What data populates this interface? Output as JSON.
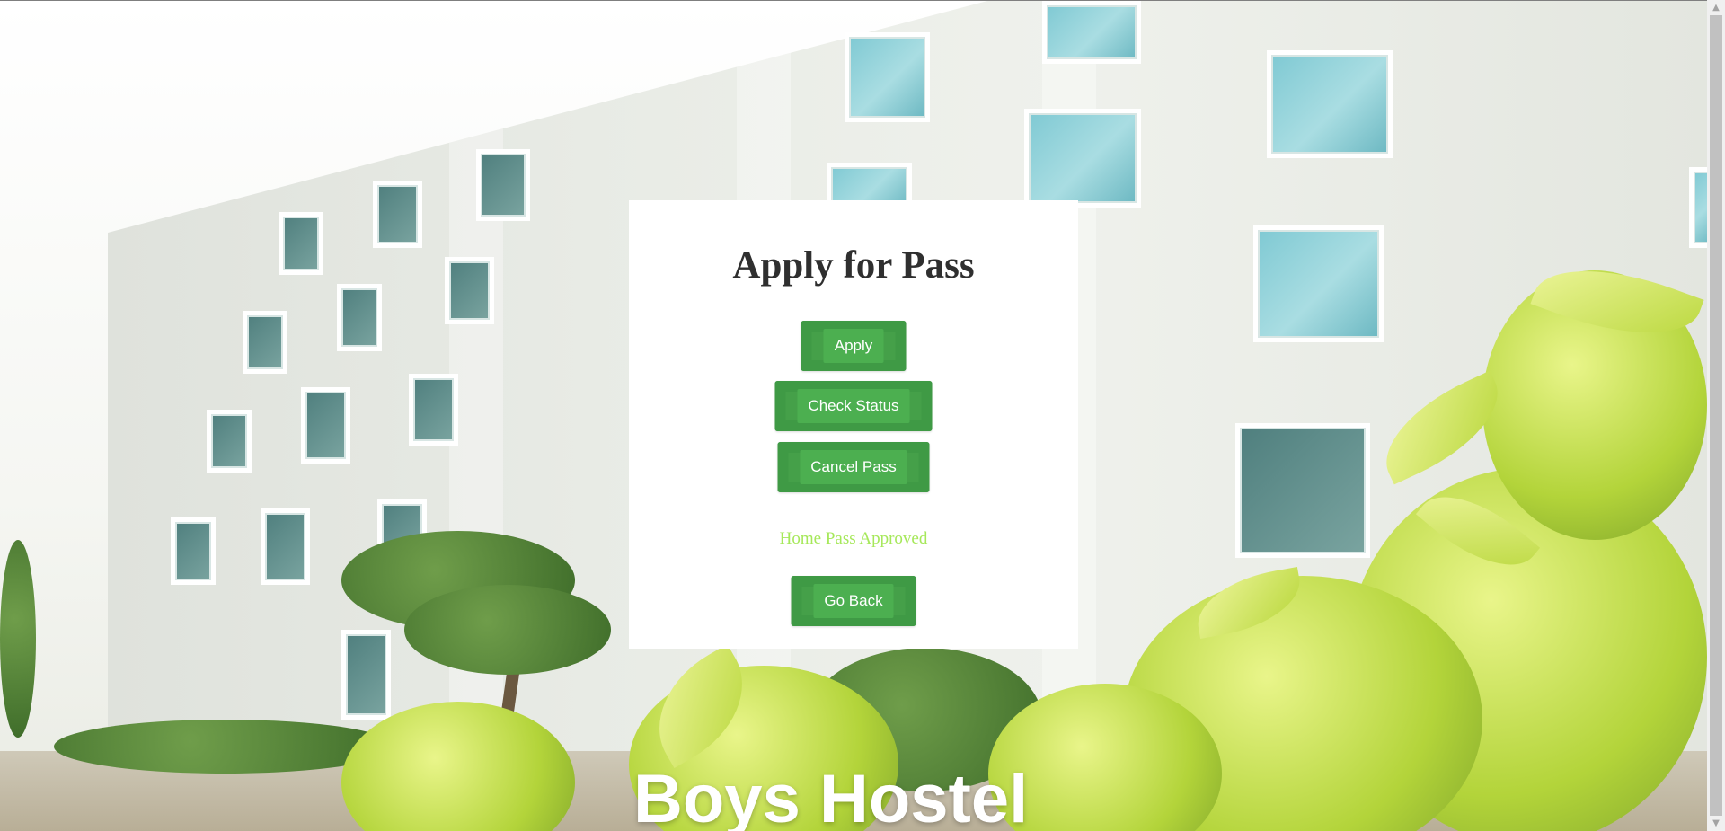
{
  "page": {
    "heading": "Apply for Pass",
    "status_message": "Home Pass Approved",
    "status_color": "#a6e85a",
    "accent_color": "#4caf50"
  },
  "buttons": {
    "apply": "Apply",
    "check_status": "Check Status",
    "cancel_pass": "Cancel Pass",
    "go_back": "Go Back"
  },
  "background": {
    "watermark_text": "Boys Hostel"
  },
  "scrollbar": {
    "up_icon": "▲",
    "down_icon": "▼"
  }
}
